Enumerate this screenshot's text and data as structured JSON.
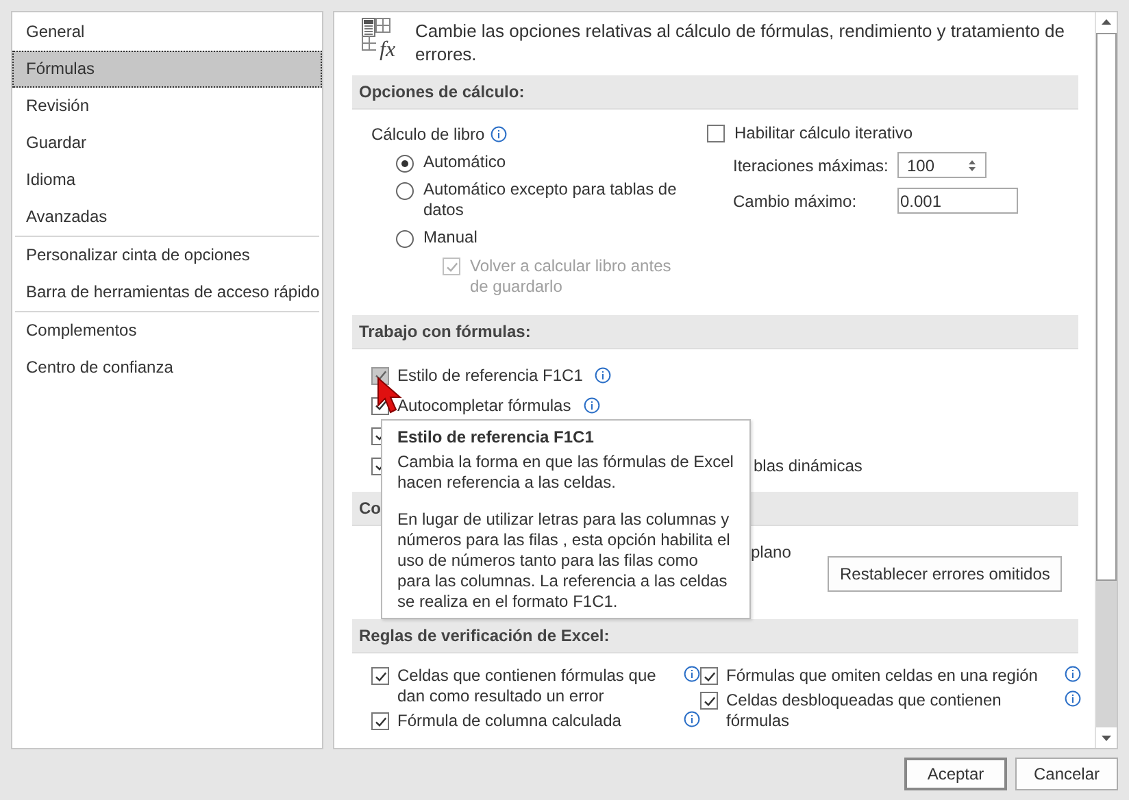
{
  "sidebar": {
    "groups": [
      [
        {
          "label": "General",
          "selected": false
        },
        {
          "label": "Fórmulas",
          "selected": true
        },
        {
          "label": "Revisión",
          "selected": false
        },
        {
          "label": "Guardar",
          "selected": false
        },
        {
          "label": "Idioma",
          "selected": false
        },
        {
          "label": "Avanzadas",
          "selected": false
        }
      ],
      [
        {
          "label": "Personalizar cinta de opciones",
          "selected": false
        },
        {
          "label": "Barra de herramientas de acceso rápido",
          "selected": false
        }
      ],
      [
        {
          "label": "Complementos",
          "selected": false
        },
        {
          "label": "Centro de confianza",
          "selected": false
        }
      ]
    ]
  },
  "header": {
    "icon_text": "fx",
    "text": "Cambie las opciones relativas al cálculo de fórmulas, rendimiento y tratamiento de errores."
  },
  "calculation": {
    "title": "Opciones de cálculo:",
    "workbook_label": "Cálculo de libro",
    "radios": [
      {
        "label": "Automático",
        "selected": true
      },
      {
        "label": "Automático excepto para tablas de datos",
        "selected": false
      },
      {
        "label": "Manual",
        "selected": false
      }
    ],
    "recalc": {
      "label": "Volver a calcular libro antes de guardarlo",
      "checked": true,
      "disabled": true
    },
    "iterative": {
      "label": "Habilitar cálculo iterativo",
      "checked": false
    },
    "max_iterations": {
      "label": "Iteraciones máximas:",
      "value": "100"
    },
    "max_change": {
      "label": "Cambio máximo:",
      "value": "0.001"
    }
  },
  "formulas": {
    "title": "Trabajo con fórmulas:",
    "options": [
      {
        "label": "Estilo de referencia F1C1",
        "checked": true,
        "info": true,
        "hover": true
      },
      {
        "label": "Autocompletar fórmulas",
        "checked": true,
        "info": true
      },
      {
        "checked": true,
        "info": false
      },
      {
        "label": "blas dinámicas",
        "checked": true,
        "info": false
      }
    ]
  },
  "errors": {
    "title": "Co",
    "text": "plano",
    "button": "Restablecer errores omitidos"
  },
  "rules": {
    "title": "Reglas de verificación de Excel:",
    "left": [
      {
        "label": "Celdas que contienen fórmulas que dan como resultado un error",
        "checked": true
      },
      {
        "label": "Fórmula de columna calculada",
        "checked": true
      }
    ],
    "right": [
      {
        "label": "Fórmulas que omiten celdas en una región",
        "checked": true
      },
      {
        "label": "Celdas desbloqueadas que contienen fórmulas",
        "checked": true
      }
    ]
  },
  "tooltip": {
    "title": "Estilo de referencia F1C1",
    "paragraphs": [
      "Cambia la forma en que las fórmulas de Excel hacen referencia a las celdas.",
      "En lugar de utilizar letras para las columnas y números para las filas , esta opción habilita el uso de números tanto para las filas como para las columnas. La referencia a las celdas se realiza en el formato F1C1."
    ]
  },
  "buttons": [
    {
      "label": "Aceptar",
      "default": true
    },
    {
      "label": "Cancelar",
      "default": false
    }
  ]
}
